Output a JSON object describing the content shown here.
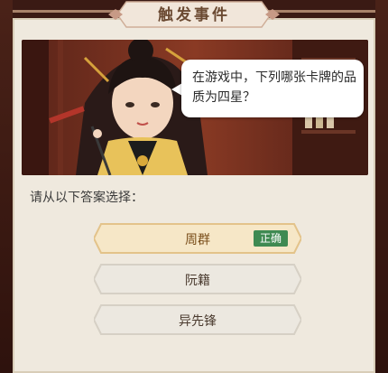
{
  "title": "触发事件",
  "question": "在游戏中，下列哪张卡牌的品质为四星？",
  "prompt": "请从以下答案选择：",
  "answers": [
    {
      "label": "周群",
      "badge": "正确",
      "selected": true
    },
    {
      "label": "阮籍",
      "badge": "",
      "selected": false
    },
    {
      "label": "异先锋",
      "badge": "",
      "selected": false
    }
  ],
  "colors": {
    "panel_bg": "#efe9de",
    "selected_fill": "#f6e7c7",
    "selected_border": "#e3c38a",
    "option_fill": "#ece8e0",
    "option_border": "#d6d0c5",
    "badge_bg": "#3f8a52",
    "frame": "#3a1a14"
  }
}
